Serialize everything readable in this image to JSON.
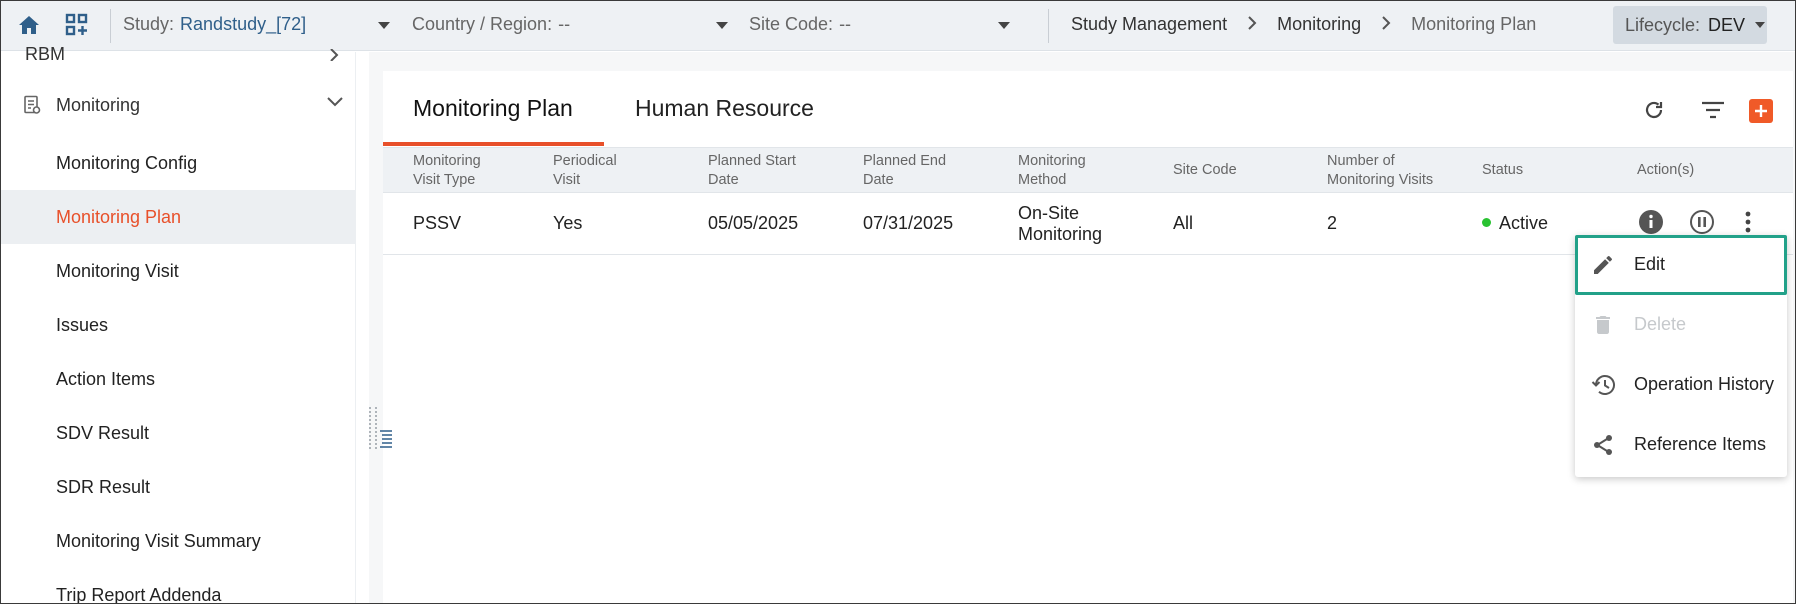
{
  "header": {
    "study_label": "Study:",
    "study_value": "Randstudy_[72]",
    "country_label": "Country / Region:",
    "country_value": "--",
    "site_label": "Site Code:",
    "site_value": "--",
    "breadcrumb": [
      "Study Management",
      "Monitoring",
      "Monitoring Plan"
    ],
    "lifecycle_label": "Lifecycle:",
    "lifecycle_value": "DEV"
  },
  "sidebar": {
    "partial_item": "RBM",
    "group": "Monitoring",
    "items": [
      {
        "label": "Monitoring Config"
      },
      {
        "label": "Monitoring Plan"
      },
      {
        "label": "Monitoring Visit"
      },
      {
        "label": "Issues"
      },
      {
        "label": "Action Items"
      },
      {
        "label": "SDV Result"
      },
      {
        "label": "SDR Result"
      },
      {
        "label": "Monitoring Visit Summary"
      },
      {
        "label": "Trip Report Addenda"
      }
    ],
    "active_index": 1
  },
  "tabs": [
    "Monitoring Plan",
    "Human Resource"
  ],
  "table": {
    "headers": [
      [
        "Monitoring",
        "Visit Type"
      ],
      [
        "Periodical",
        "Visit"
      ],
      [
        "Planned Start",
        "Date"
      ],
      [
        "Planned End",
        "Date"
      ],
      [
        "Monitoring",
        "Method"
      ],
      [
        "Site Code"
      ],
      [
        "Number of",
        "Monitoring Visits"
      ],
      [
        "Status"
      ],
      [
        "Action(s)"
      ]
    ],
    "rows": [
      {
        "visit_type": "PSSV",
        "periodical": "Yes",
        "start": "05/05/2025",
        "end": "07/31/2025",
        "method_line1": "On-Site",
        "method_line2": "Monitoring",
        "site_code": "All",
        "visits": "2",
        "status": "Active"
      }
    ]
  },
  "menu": {
    "items": [
      {
        "label": "Edit",
        "icon": "pencil-icon",
        "disabled": false
      },
      {
        "label": "Delete",
        "icon": "trash-icon",
        "disabled": true
      },
      {
        "label": "Operation History",
        "icon": "history-icon",
        "disabled": false
      },
      {
        "label": "Reference Items",
        "icon": "share-icon",
        "disabled": false
      }
    ]
  },
  "colors": {
    "accent": "#e8502a",
    "status_active": "#29c231",
    "highlight_outline": "#22a189",
    "link_blue": "#2f5f8a"
  }
}
